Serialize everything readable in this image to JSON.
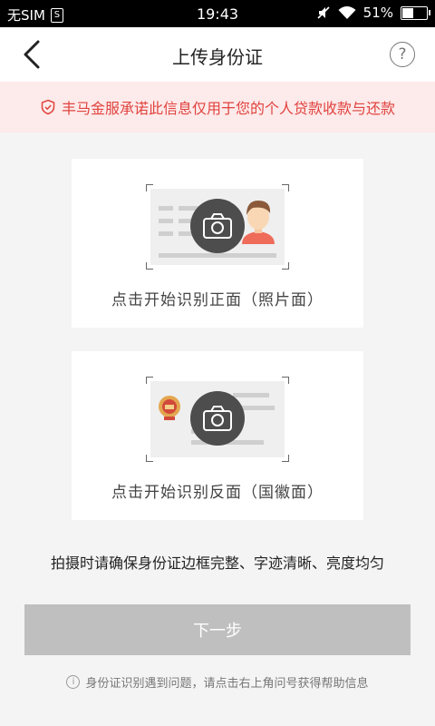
{
  "status_bar": {
    "carrier": "无SIM",
    "sim_badge": "S",
    "time": "19:43",
    "battery_text": "51%",
    "battery_level": 0.51,
    "icons": [
      "mute-icon",
      "wifi-icon",
      "battery-icon"
    ]
  },
  "nav": {
    "title": "上传身份证",
    "help_symbol": "?"
  },
  "notice": {
    "text": "丰马金服承诺此信息仅用于您的个人贷款收款与还款",
    "color": "#e0433f",
    "background": "#fdeaea"
  },
  "cards": {
    "front_label": "点击开始识别正面（照片面）",
    "back_label": "点击开始识别反面（国徽面）"
  },
  "tip": "拍摄时请确保身份证边框完整、字迹清晰、亮度均匀",
  "next_button": {
    "label": "下一步",
    "background": "#bfbfbf"
  },
  "bottom_hint": {
    "info_symbol": "i",
    "text": "身份证识别遇到问题，请点击右上角问号获得帮助信息"
  }
}
